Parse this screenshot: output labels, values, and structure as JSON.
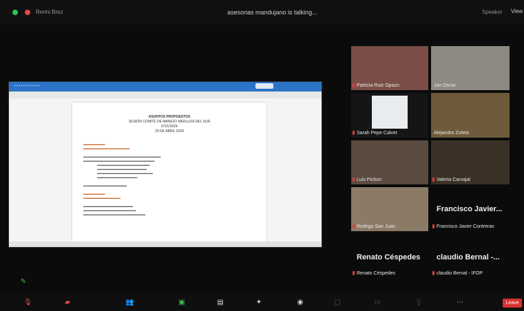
{
  "topbar": {
    "left_name": "Renni Brez",
    "meeting_title": "asesorias mandujano is talking...",
    "speaker_view": "Speaker",
    "view": "View"
  },
  "share": {
    "document_heading": [
      "ASUNTOS PROPUESTOS",
      "SESIÓN COMITÉ DE MANEJO MERLUZA DEL SUR",
      "N°01/2024",
      "25 DE ABRIL 2024"
    ]
  },
  "participants": [
    {
      "name": "Patricia Ruiz Opazo",
      "muted": true
    },
    {
      "name": "Jan Oscar",
      "muted": false
    },
    {
      "name": "Sarah Pepe Calvet",
      "muted": true
    },
    {
      "name": "Alejandro Zuleta",
      "muted": false
    },
    {
      "name": "Luis Pichon",
      "muted": true
    },
    {
      "name": "Valeria Carvajal",
      "muted": true
    },
    {
      "name": "Rodrigo San Juan",
      "muted": true
    },
    {
      "name": "Francisco Javier...",
      "muted": false
    },
    {
      "name": "Francisco Javier Contreras",
      "muted": true
    },
    {
      "name": "Renato Céspedes",
      "muted": false
    },
    {
      "name": "claudio Bernal -...",
      "muted": false
    },
    {
      "name": "Renato Céspedes",
      "muted": true
    },
    {
      "name": "claudio Bernal - IFOP",
      "muted": true
    }
  ],
  "bottombar": {
    "leave_label": "Leave"
  },
  "colors": {
    "accent_blue": "#2b74c8",
    "leave_red": "#d6322e",
    "mic_red": "#e23b3b"
  }
}
